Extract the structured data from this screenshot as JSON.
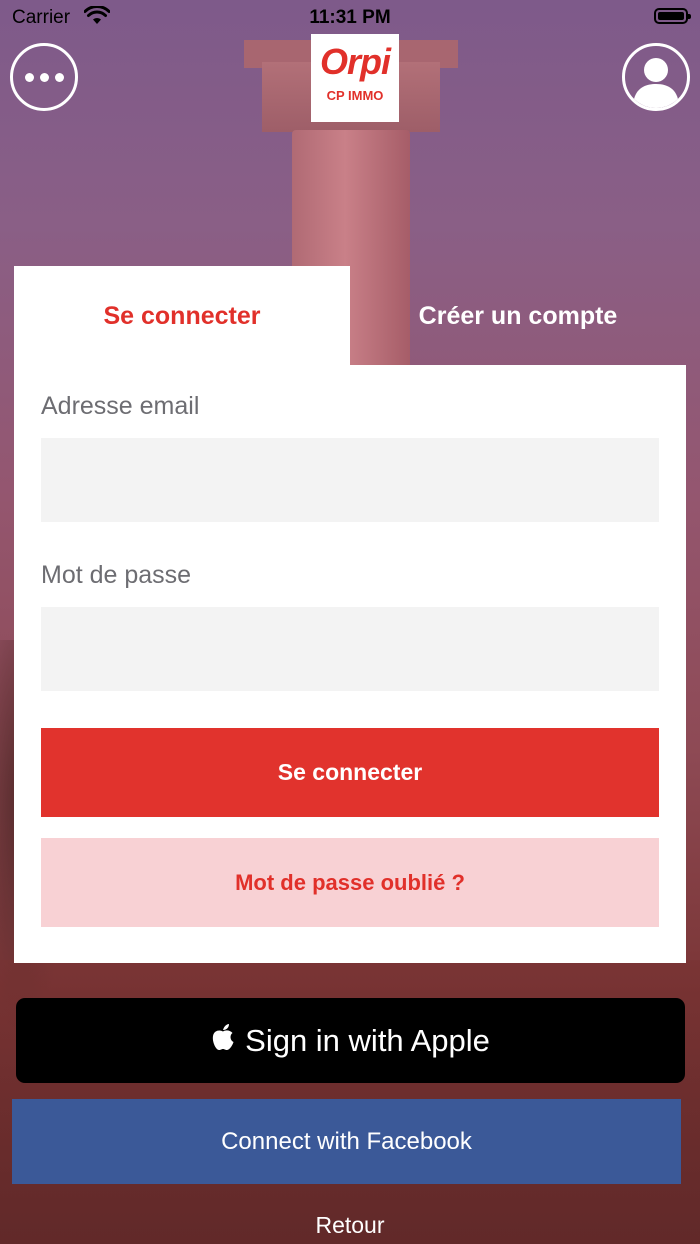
{
  "status_bar": {
    "carrier": "Carrier",
    "time": "11:31 PM"
  },
  "header": {
    "logo_word": "Orpi",
    "logo_sub": "CP IMMO",
    "menu_icon": "more-dots-icon",
    "profile_icon": "user-profile-icon"
  },
  "tabs": [
    {
      "label": "Se connecter",
      "active": true
    },
    {
      "label": "Créer un compte",
      "active": false
    }
  ],
  "form": {
    "email_label": "Adresse email",
    "email_value": "",
    "password_label": "Mot de passe",
    "password_value": "",
    "login_button": "Se connecter",
    "forgot_button": "Mot de passe oublié ?"
  },
  "social": {
    "apple_label": "Sign in with Apple",
    "apple_icon": "apple-logo-icon",
    "facebook_label": "Connect with Facebook"
  },
  "back_label": "Retour",
  "colors": {
    "brand_red": "#e1302a",
    "forgot_bg": "#f8d1d4",
    "facebook_blue": "#3b5998"
  }
}
